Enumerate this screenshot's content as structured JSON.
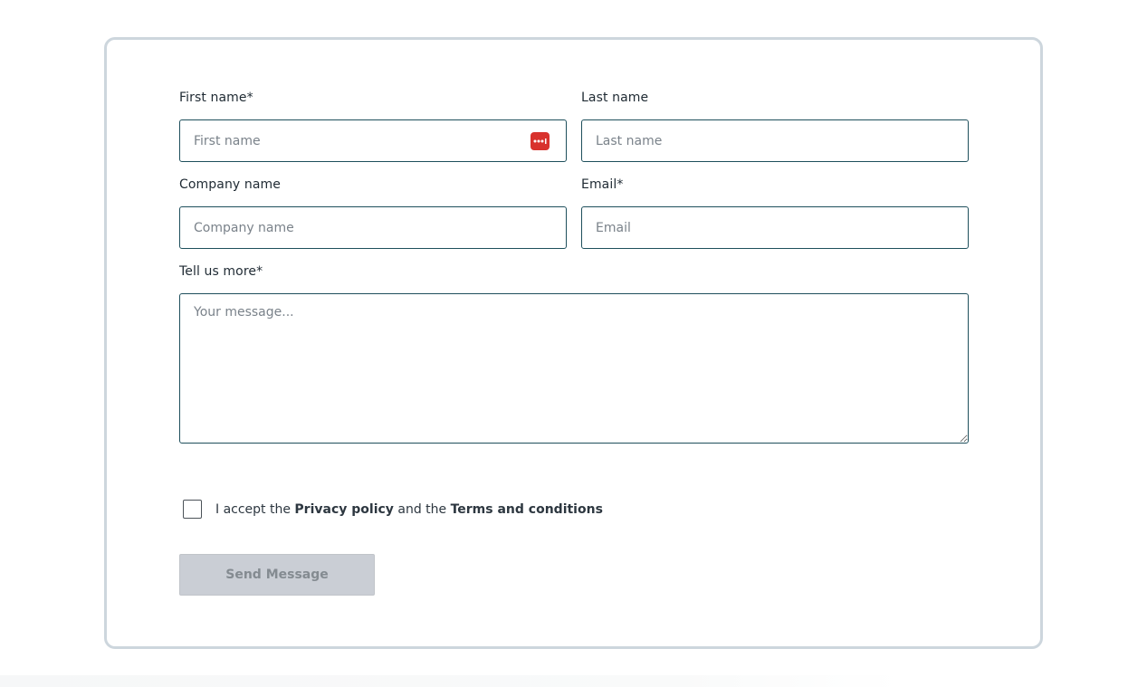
{
  "form": {
    "first_name": {
      "label": "First name*",
      "placeholder": "First name",
      "value": ""
    },
    "last_name": {
      "label": "Last name",
      "placeholder": "Last name",
      "value": ""
    },
    "company_name": {
      "label": "Company name",
      "placeholder": "Company name",
      "value": ""
    },
    "email": {
      "label": "Email*",
      "placeholder": "Email",
      "value": ""
    },
    "message": {
      "label": "Tell us more*",
      "placeholder": "Your message...",
      "value": ""
    },
    "consent": {
      "prefix": "I accept the ",
      "privacy_link": "Privacy policy",
      "middle": " and the ",
      "terms_link": "Terms and conditions",
      "checked": false
    },
    "submit_label": "Send Message"
  },
  "icons": {
    "password_manager": "password-manager-icon"
  },
  "colors": {
    "input_border": "#1e4f5c",
    "card_border": "#cdd6dd",
    "button_disabled_bg": "#caced5",
    "button_disabled_text": "#848b91",
    "password_icon_bg": "#d8322d"
  }
}
